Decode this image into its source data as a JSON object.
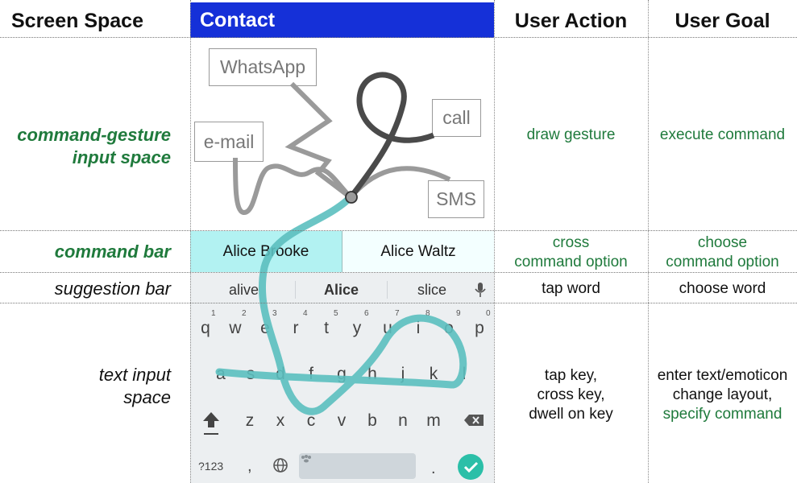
{
  "headers": {
    "screen_space": "Screen Space",
    "user_action": "User Action",
    "user_goal": "User Goal"
  },
  "phone": {
    "app_title": "Contact",
    "commands": {
      "whatsapp": "WhatsApp",
      "call": "call",
      "email": "e-mail",
      "sms": "SMS"
    },
    "command_bar": {
      "left": "Alice Brooke",
      "right": "Alice Waltz"
    },
    "suggestions": [
      "alive",
      "Alice",
      "slice"
    ],
    "keyboard": {
      "row1": [
        "q",
        "w",
        "e",
        "r",
        "t",
        "y",
        "u",
        "i",
        "o",
        "p"
      ],
      "row1_nums": [
        "1",
        "2",
        "3",
        "4",
        "5",
        "6",
        "7",
        "8",
        "9",
        "0"
      ],
      "row2": [
        "a",
        "s",
        "d",
        "f",
        "g",
        "h",
        "j",
        "k",
        "l"
      ],
      "row3": [
        "z",
        "x",
        "c",
        "v",
        "b",
        "n",
        "m"
      ],
      "symbols_key": "?123",
      "comma_key": ",",
      "period_key": "."
    }
  },
  "rows": [
    {
      "label_line1": "command-gesture",
      "label_line2": "input space",
      "action": "draw gesture",
      "goal": "execute command"
    },
    {
      "label": "command  bar",
      "action_line1": "cross",
      "action_line2": "command option",
      "goal_line1": "choose",
      "goal_line2": "command option"
    },
    {
      "label": "suggestion bar",
      "action": "tap word",
      "goal": "choose word"
    },
    {
      "label_line1": "text input",
      "label_line2": "space",
      "action_line1": "tap key,",
      "action_line2": "cross key,",
      "action_line3": "dwell on key",
      "goal_line1": "enter text/emoticon",
      "goal_line2": "change layout,",
      "goal_line3": "specify command"
    }
  ],
  "colors": {
    "appbar": "#1530d8",
    "command_bar_selected": "#b2f2f2",
    "gesture_trace": "#5bbfbf",
    "green_text": "#1f7a3c"
  }
}
